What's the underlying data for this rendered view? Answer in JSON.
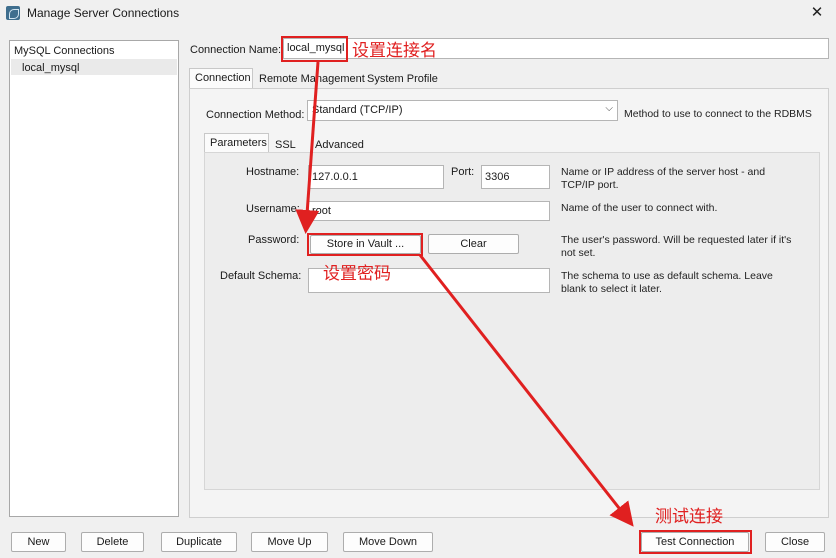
{
  "window": {
    "title": "Manage Server Connections",
    "close_icon": "close-icon"
  },
  "sidebar": {
    "group_label": "MySQL Connections",
    "items": [
      {
        "label": "local_mysql"
      }
    ]
  },
  "connection_name": {
    "label": "Connection Name:",
    "value": "local_mysql"
  },
  "main_tabs": [
    {
      "label": "Connection"
    },
    {
      "label": "Remote Management"
    },
    {
      "label": "System Profile"
    }
  ],
  "connection_method": {
    "label": "Connection Method:",
    "value": "Standard (TCP/IP)",
    "hint": "Method to use to connect to the RDBMS"
  },
  "sub_tabs": [
    {
      "label": "Parameters"
    },
    {
      "label": "SSL"
    },
    {
      "label": "Advanced"
    }
  ],
  "params": {
    "hostname_label": "Hostname:",
    "hostname_value": "127.0.0.1",
    "port_label": "Port:",
    "port_value": "3306",
    "hostname_hint_1": "Name or IP address of the server host - and",
    "hostname_hint_2": "TCP/IP port.",
    "username_label": "Username:",
    "username_value": "root",
    "username_hint": "Name of the user to connect with.",
    "password_label": "Password:",
    "store_vault_label": "Store in Vault ...",
    "clear_label": "Clear",
    "password_hint_1": "The user's password. Will be requested later if it's",
    "password_hint_2": "not set.",
    "schema_label": "Default Schema:",
    "schema_value": "",
    "schema_hint_1": "The schema to use as default schema. Leave",
    "schema_hint_2": "blank to select it later."
  },
  "footer": {
    "new": "New",
    "delete": "Delete",
    "duplicate": "Duplicate",
    "move_up": "Move Up",
    "move_down": "Move Down",
    "test_connection": "Test Connection",
    "close": "Close"
  },
  "annotations": {
    "set_name": "设置连接名",
    "set_password": "设置密码",
    "test_connection": "测试连接",
    "highlight_color": "#e02020"
  }
}
